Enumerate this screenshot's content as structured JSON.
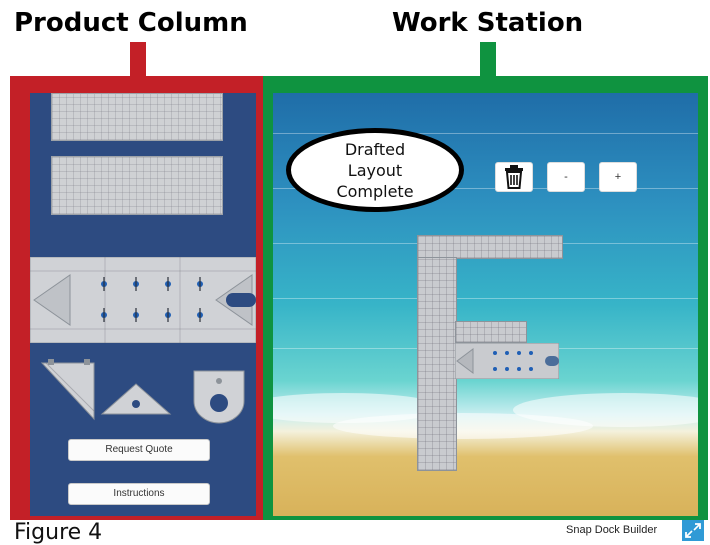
{
  "headings": {
    "product_column": "Product Column",
    "work_station": "Work Station"
  },
  "colors": {
    "product_frame": "#c32027",
    "work_station_frame": "#0f9340",
    "product_panel": "#2d4b81",
    "expand_button": "#2f9ad6"
  },
  "product_column": {
    "buttons": {
      "request_quote": "Request Quote",
      "instructions": "Instructions"
    },
    "products": [
      "dock-section-small",
      "dock-section-large",
      "dock-section-with-cleats",
      "corner-triangle",
      "gusset-plate",
      "rounded-end-cap"
    ]
  },
  "work_station": {
    "callout": "Drafted\nLayout\nComplete",
    "toolbar": {
      "delete_icon": "trash-icon",
      "zoom_out": "-",
      "zoom_in": "+"
    }
  },
  "footer": {
    "figure": "Figure 4",
    "brand": "Snap Dock Builder",
    "expand_icon": "expand-icon"
  }
}
